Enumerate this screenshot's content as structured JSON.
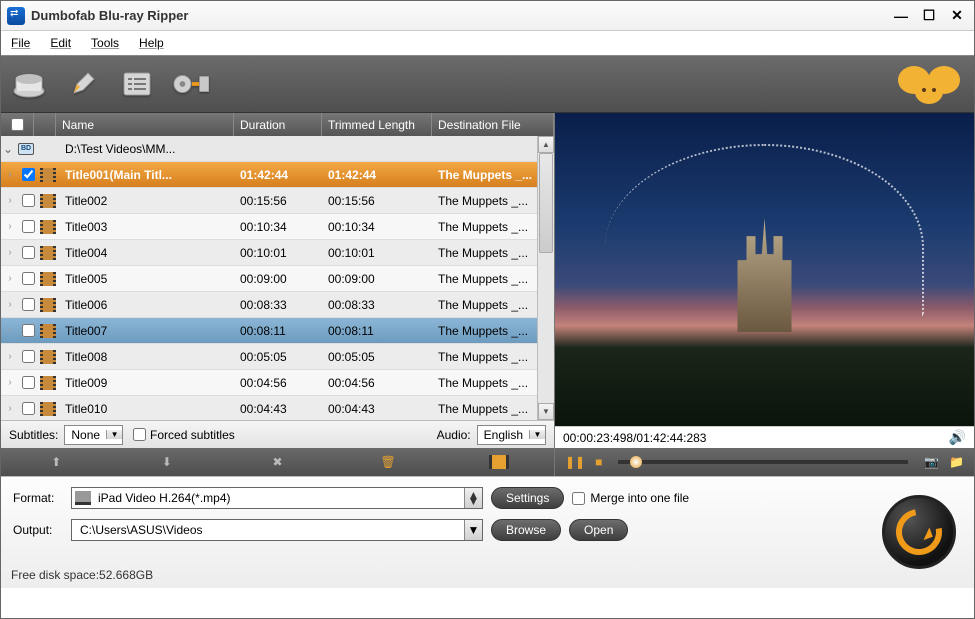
{
  "window": {
    "title": "Dumbofab Blu-ray Ripper"
  },
  "menu": {
    "file": "File",
    "edit": "Edit",
    "tools": "Tools",
    "help": "Help"
  },
  "columns": {
    "name": "Name",
    "duration": "Duration",
    "trimmed": "Trimmed Length",
    "dest": "Destination File"
  },
  "parent_row": {
    "path": "D:\\Test Videos\\MM..."
  },
  "rows": [
    {
      "name": "Title001(Main Titl...",
      "dur": "01:42:44",
      "trim": "01:42:44",
      "dest": "The Muppets _...",
      "checked": true,
      "selected": true,
      "caret": true
    },
    {
      "name": "Title002",
      "dur": "00:15:56",
      "trim": "00:15:56",
      "dest": "The Muppets _...",
      "caret": true
    },
    {
      "name": "Title003",
      "dur": "00:10:34",
      "trim": "00:10:34",
      "dest": "The Muppets _...",
      "caret": true
    },
    {
      "name": "Title004",
      "dur": "00:10:01",
      "trim": "00:10:01",
      "dest": "The Muppets _...",
      "caret": true
    },
    {
      "name": "Title005",
      "dur": "00:09:00",
      "trim": "00:09:00",
      "dest": "The Muppets _...",
      "caret": true
    },
    {
      "name": "Title006",
      "dur": "00:08:33",
      "trim": "00:08:33",
      "dest": "The Muppets _...",
      "caret": true
    },
    {
      "name": "Title007",
      "dur": "00:08:11",
      "trim": "00:08:11",
      "dest": "The Muppets _...",
      "caret": true,
      "highlight": true
    },
    {
      "name": "Title008",
      "dur": "00:05:05",
      "trim": "00:05:05",
      "dest": "The Muppets _...",
      "caret": true
    },
    {
      "name": "Title009",
      "dur": "00:04:56",
      "trim": "00:04:56",
      "dest": "The Muppets _...",
      "caret": true
    },
    {
      "name": "Title010",
      "dur": "00:04:43",
      "trim": "00:04:43",
      "dest": "The Muppets _...",
      "caret": true
    }
  ],
  "subtitles": {
    "label": "Subtitles:",
    "value": "None",
    "forced_label": "Forced subtitles"
  },
  "audio": {
    "label": "Audio:",
    "value": "English"
  },
  "time_display": "00:00:23:498/01:42:44:283",
  "format": {
    "label": "Format:",
    "value": "iPad Video H.264(*.mp4)"
  },
  "output": {
    "label": "Output:",
    "value": "C:\\Users\\ASUS\\Videos"
  },
  "buttons": {
    "settings": "Settings",
    "browse": "Browse",
    "open": "Open"
  },
  "merge_label": "Merge into one file",
  "free_disk": "Free disk space:52.668GB"
}
